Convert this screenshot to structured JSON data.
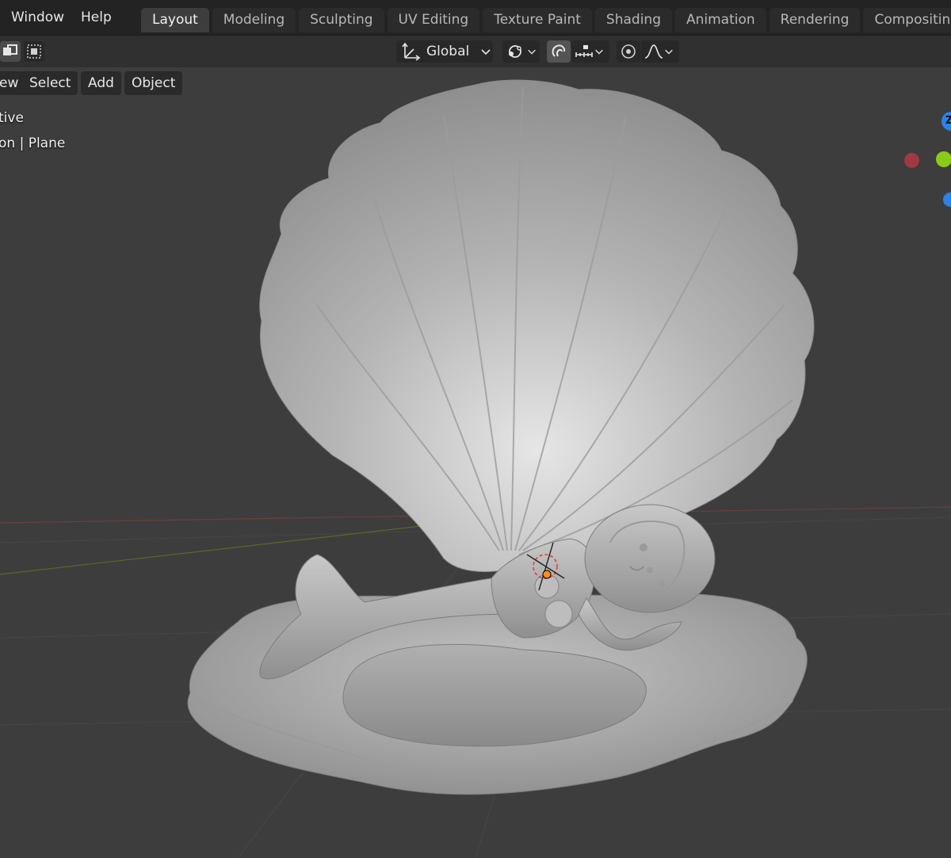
{
  "topbar": {
    "menus": [
      "Window",
      "Help"
    ],
    "workspaces": [
      "Layout",
      "Modeling",
      "Sculpting",
      "UV Editing",
      "Texture Paint",
      "Shading",
      "Animation",
      "Rendering",
      "Compositing"
    ],
    "active_workspace": "Layout"
  },
  "header": {
    "transform_orientation": "Global",
    "icons": [
      "select-mode-icon",
      "orientation-axes-icon",
      "pivot-point-icon",
      "snap-magnet-icon",
      "snap-increment-icon",
      "proportional-edit-icon",
      "falloff-curve-icon"
    ]
  },
  "viewport": {
    "menus": {
      "view": "ew",
      "select": "Select",
      "add": "Add",
      "object": "Object"
    },
    "overlay": {
      "view_mode": "tive",
      "collection_object": "on | Plane"
    },
    "gizmo": {
      "z_label": "Z",
      "colors": {
        "x": "#cc3b46",
        "y": "#8acb18",
        "z": "#2c82e6"
      }
    }
  },
  "colors": {
    "background": "#3d3d3d",
    "topbar": "#232323",
    "active_tab": "#3d3d3d",
    "origin_marker": "#ff8d1a"
  }
}
